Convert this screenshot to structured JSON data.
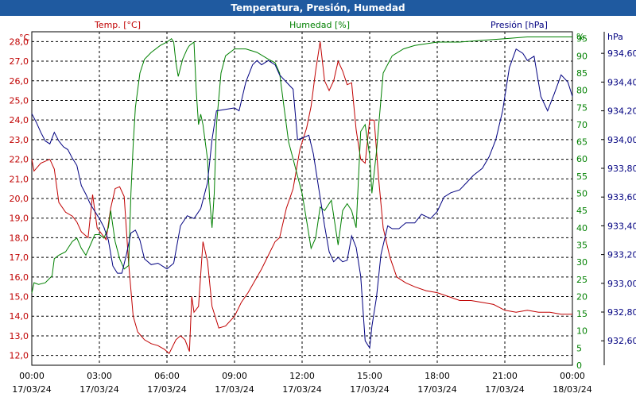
{
  "window": {
    "title": "Temperatura, Presión, Humedad"
  },
  "chart_data": {
    "type": "line",
    "title": "Temperatura, Presión, Humedad",
    "grid": true,
    "x_ticks": [
      {
        "time": "00:00",
        "date": "17/03/24"
      },
      {
        "time": "03:00",
        "date": "17/03/24"
      },
      {
        "time": "06:00",
        "date": "17/03/24"
      },
      {
        "time": "09:00",
        "date": "17/03/24"
      },
      {
        "time": "12:00",
        "date": "17/03/24"
      },
      {
        "time": "15:00",
        "date": "17/03/24"
      },
      {
        "time": "18:00",
        "date": "17/03/24"
      },
      {
        "time": "21:00",
        "date": "17/03/24"
      },
      {
        "time": "00:00",
        "date": "18/03/24"
      }
    ],
    "xlim": [
      0,
      24
    ],
    "axes": {
      "temp": {
        "label": "Temp. [°C]",
        "unit": "°C",
        "color": "#c00000",
        "range": [
          11.5,
          28.5
        ],
        "ticks": [
          "12,0",
          "13,0",
          "14,0",
          "15,0",
          "16,0",
          "17,0",
          "18,0",
          "19,0",
          "20,0",
          "21,0",
          "22,0",
          "23,0",
          "24,0",
          "25,0",
          "26,0",
          "27,0",
          "28,0"
        ],
        "tick_values": [
          12,
          13,
          14,
          15,
          16,
          17,
          18,
          19,
          20,
          21,
          22,
          23,
          24,
          25,
          26,
          27,
          28
        ]
      },
      "hum": {
        "label": "Humedad [%]",
        "unit": "%",
        "color": "#008000",
        "range": [
          0,
          97
        ],
        "ticks": [
          "0",
          "5",
          "10",
          "15",
          "20",
          "25",
          "30",
          "35",
          "40",
          "45",
          "50",
          "55",
          "60",
          "65",
          "70",
          "75",
          "80",
          "85",
          "90",
          "95"
        ],
        "tick_values": [
          0,
          5,
          10,
          15,
          20,
          25,
          30,
          35,
          40,
          45,
          50,
          55,
          60,
          65,
          70,
          75,
          80,
          85,
          90,
          95
        ]
      },
      "pres": {
        "label": "Presión [hPa]",
        "unit": "hPa",
        "color": "#000080",
        "range": [
          932.43,
          934.75
        ],
        "ticks": [
          "932,60",
          "932,80",
          "933,00",
          "933,20",
          "933,40",
          "933,60",
          "933,80",
          "934,00",
          "934,20",
          "934,40",
          "934,60"
        ],
        "tick_values": [
          932.6,
          932.8,
          933.0,
          933.2,
          933.4,
          933.6,
          933.8,
          934.0,
          934.2,
          934.4,
          934.6
        ]
      }
    },
    "series": [
      {
        "name": "Temp. [°C]",
        "axis": "temp",
        "color": "#c00000",
        "points": [
          [
            0,
            22.0
          ],
          [
            0.1,
            21.4
          ],
          [
            0.4,
            21.8
          ],
          [
            0.8,
            22.0
          ],
          [
            1.0,
            21.5
          ],
          [
            1.2,
            19.8
          ],
          [
            1.5,
            19.3
          ],
          [
            1.8,
            19.1
          ],
          [
            2.0,
            18.8
          ],
          [
            2.2,
            18.3
          ],
          [
            2.5,
            18.0
          ],
          [
            2.7,
            20.2
          ],
          [
            2.9,
            18.5
          ],
          [
            3.1,
            18.2
          ],
          [
            3.3,
            17.9
          ],
          [
            3.5,
            19.5
          ],
          [
            3.7,
            20.5
          ],
          [
            3.9,
            20.6
          ],
          [
            4.1,
            20.1
          ],
          [
            4.3,
            16.7
          ],
          [
            4.5,
            14.0
          ],
          [
            4.7,
            13.2
          ],
          [
            5.0,
            12.8
          ],
          [
            5.3,
            12.6
          ],
          [
            5.6,
            12.5
          ],
          [
            5.9,
            12.3
          ],
          [
            6.1,
            12.1
          ],
          [
            6.4,
            12.8
          ],
          [
            6.6,
            13.0
          ],
          [
            6.8,
            12.8
          ],
          [
            7.0,
            12.2
          ],
          [
            7.1,
            15.0
          ],
          [
            7.2,
            14.2
          ],
          [
            7.4,
            14.5
          ],
          [
            7.6,
            17.8
          ],
          [
            7.8,
            16.8
          ],
          [
            8.0,
            14.5
          ],
          [
            8.3,
            13.4
          ],
          [
            8.6,
            13.5
          ],
          [
            9.0,
            14.0
          ],
          [
            9.3,
            14.7
          ],
          [
            9.6,
            15.2
          ],
          [
            9.9,
            15.8
          ],
          [
            10.2,
            16.4
          ],
          [
            10.5,
            17.1
          ],
          [
            10.8,
            17.8
          ],
          [
            11.0,
            18.0
          ],
          [
            11.3,
            19.5
          ],
          [
            11.6,
            20.5
          ],
          [
            11.9,
            22.5
          ],
          [
            12.2,
            23.6
          ],
          [
            12.4,
            24.7
          ],
          [
            12.6,
            26.5
          ],
          [
            12.8,
            28.0
          ],
          [
            13.0,
            26.0
          ],
          [
            13.2,
            25.5
          ],
          [
            13.4,
            26.0
          ],
          [
            13.6,
            27.0
          ],
          [
            13.8,
            26.5
          ],
          [
            14.0,
            25.8
          ],
          [
            14.2,
            25.9
          ],
          [
            14.4,
            23.5
          ],
          [
            14.6,
            22.0
          ],
          [
            14.8,
            21.8
          ],
          [
            15.0,
            24.0
          ],
          [
            15.2,
            24.0
          ],
          [
            15.4,
            21.0
          ],
          [
            15.6,
            18.5
          ],
          [
            15.9,
            17.0
          ],
          [
            16.2,
            16.0
          ],
          [
            16.6,
            15.7
          ],
          [
            17.0,
            15.5
          ],
          [
            17.5,
            15.3
          ],
          [
            18.0,
            15.2
          ],
          [
            18.5,
            15.0
          ],
          [
            19.0,
            14.8
          ],
          [
            19.5,
            14.8
          ],
          [
            20.0,
            14.7
          ],
          [
            20.5,
            14.6
          ],
          [
            21.0,
            14.3
          ],
          [
            21.5,
            14.2
          ],
          [
            22.0,
            14.3
          ],
          [
            22.5,
            14.2
          ],
          [
            23.0,
            14.2
          ],
          [
            23.5,
            14.1
          ],
          [
            24.0,
            14.1
          ]
        ]
      },
      {
        "name": "Humedad [%]",
        "axis": "hum",
        "color": "#008000",
        "points": [
          [
            0,
            21
          ],
          [
            0.1,
            24
          ],
          [
            0.3,
            23.5
          ],
          [
            0.6,
            24
          ],
          [
            0.9,
            26
          ],
          [
            1.0,
            31
          ],
          [
            1.2,
            32
          ],
          [
            1.5,
            33
          ],
          [
            1.8,
            36
          ],
          [
            2.0,
            37
          ],
          [
            2.2,
            34
          ],
          [
            2.4,
            32
          ],
          [
            2.6,
            35
          ],
          [
            2.8,
            38
          ],
          [
            3.0,
            38
          ],
          [
            3.2,
            37
          ],
          [
            3.4,
            40
          ],
          [
            3.5,
            45
          ],
          [
            3.7,
            36
          ],
          [
            3.9,
            31
          ],
          [
            4.1,
            28
          ],
          [
            4.3,
            29
          ],
          [
            4.4,
            50
          ],
          [
            4.5,
            64
          ],
          [
            4.6,
            75
          ],
          [
            4.8,
            85
          ],
          [
            5.0,
            89
          ],
          [
            5.3,
            91
          ],
          [
            5.7,
            93
          ],
          [
            6.0,
            94
          ],
          [
            6.2,
            95
          ],
          [
            6.3,
            94
          ],
          [
            6.4,
            88
          ],
          [
            6.5,
            84
          ],
          [
            6.7,
            89
          ],
          [
            6.9,
            92
          ],
          [
            7.0,
            93
          ],
          [
            7.2,
            94
          ],
          [
            7.3,
            80
          ],
          [
            7.4,
            70
          ],
          [
            7.5,
            73
          ],
          [
            7.6,
            70
          ],
          [
            7.8,
            60
          ],
          [
            7.9,
            48
          ],
          [
            8.0,
            40
          ],
          [
            8.1,
            50
          ],
          [
            8.2,
            70
          ],
          [
            8.4,
            85
          ],
          [
            8.6,
            90
          ],
          [
            9.0,
            92
          ],
          [
            9.5,
            92
          ],
          [
            10.0,
            91
          ],
          [
            10.5,
            89
          ],
          [
            10.8,
            88
          ],
          [
            11.0,
            85
          ],
          [
            11.2,
            75
          ],
          [
            11.4,
            65
          ],
          [
            11.6,
            60
          ],
          [
            11.8,
            55
          ],
          [
            12.0,
            50
          ],
          [
            12.2,
            42
          ],
          [
            12.4,
            34
          ],
          [
            12.6,
            37
          ],
          [
            12.8,
            46
          ],
          [
            13.0,
            45
          ],
          [
            13.3,
            48
          ],
          [
            13.6,
            35
          ],
          [
            13.8,
            45
          ],
          [
            14.0,
            47
          ],
          [
            14.2,
            45
          ],
          [
            14.4,
            40
          ],
          [
            14.6,
            68
          ],
          [
            14.8,
            70
          ],
          [
            15.0,
            61
          ],
          [
            15.1,
            50
          ],
          [
            15.3,
            62
          ],
          [
            15.6,
            85
          ],
          [
            16.0,
            90
          ],
          [
            16.5,
            92
          ],
          [
            17.0,
            93
          ],
          [
            18.0,
            94
          ],
          [
            19.0,
            94
          ],
          [
            20.0,
            94.5
          ],
          [
            21.0,
            95
          ],
          [
            22.0,
            95.5
          ],
          [
            23.0,
            95.5
          ],
          [
            24.0,
            95.5
          ]
        ]
      },
      {
        "name": "Presión [hPa]",
        "axis": "pres",
        "color": "#000080",
        "points": [
          [
            0,
            934.18
          ],
          [
            0.2,
            934.12
          ],
          [
            0.4,
            934.05
          ],
          [
            0.6,
            933.99
          ],
          [
            0.8,
            933.97
          ],
          [
            1.0,
            934.05
          ],
          [
            1.2,
            933.99
          ],
          [
            1.4,
            933.95
          ],
          [
            1.6,
            933.93
          ],
          [
            1.8,
            933.87
          ],
          [
            2.0,
            933.82
          ],
          [
            2.2,
            933.68
          ],
          [
            2.4,
            933.62
          ],
          [
            2.6,
            933.55
          ],
          [
            2.8,
            933.5
          ],
          [
            3.0,
            933.45
          ],
          [
            3.2,
            933.39
          ],
          [
            3.4,
            933.3
          ],
          [
            3.6,
            933.12
          ],
          [
            3.8,
            933.07
          ],
          [
            4.0,
            933.07
          ],
          [
            4.2,
            933.2
          ],
          [
            4.4,
            933.35
          ],
          [
            4.6,
            933.37
          ],
          [
            4.8,
            933.3
          ],
          [
            5.0,
            933.17
          ],
          [
            5.3,
            933.13
          ],
          [
            5.6,
            933.14
          ],
          [
            6.0,
            933.1
          ],
          [
            6.3,
            933.14
          ],
          [
            6.6,
            933.4
          ],
          [
            6.9,
            933.47
          ],
          [
            7.2,
            933.45
          ],
          [
            7.5,
            933.52
          ],
          [
            7.8,
            933.7
          ],
          [
            8.0,
            934.0
          ],
          [
            8.2,
            934.2
          ],
          [
            8.6,
            934.21
          ],
          [
            9.0,
            934.22
          ],
          [
            9.2,
            934.2
          ],
          [
            9.5,
            934.4
          ],
          [
            9.8,
            934.52
          ],
          [
            10.0,
            934.55
          ],
          [
            10.2,
            934.52
          ],
          [
            10.5,
            934.55
          ],
          [
            10.8,
            934.52
          ],
          [
            11.0,
            934.45
          ],
          [
            11.3,
            934.4
          ],
          [
            11.6,
            934.35
          ],
          [
            11.8,
            934.0
          ],
          [
            12.0,
            934.01
          ],
          [
            12.3,
            934.03
          ],
          [
            12.5,
            933.9
          ],
          [
            12.7,
            933.7
          ],
          [
            13.0,
            933.4
          ],
          [
            13.2,
            933.22
          ],
          [
            13.4,
            933.15
          ],
          [
            13.6,
            933.18
          ],
          [
            13.8,
            933.15
          ],
          [
            14.0,
            933.16
          ],
          [
            14.2,
            933.33
          ],
          [
            14.4,
            933.25
          ],
          [
            14.6,
            933.05
          ],
          [
            14.8,
            932.6
          ],
          [
            15.0,
            932.55
          ],
          [
            15.1,
            932.7
          ],
          [
            15.3,
            932.9
          ],
          [
            15.5,
            933.2
          ],
          [
            15.8,
            933.4
          ],
          [
            16.0,
            933.38
          ],
          [
            16.3,
            933.38
          ],
          [
            16.6,
            933.42
          ],
          [
            17.0,
            933.42
          ],
          [
            17.3,
            933.48
          ],
          [
            17.7,
            933.45
          ],
          [
            18.0,
            933.5
          ],
          [
            18.3,
            933.6
          ],
          [
            18.6,
            933.63
          ],
          [
            19.0,
            933.65
          ],
          [
            19.3,
            933.7
          ],
          [
            19.6,
            933.75
          ],
          [
            20.0,
            933.8
          ],
          [
            20.3,
            933.88
          ],
          [
            20.6,
            934.0
          ],
          [
            20.9,
            934.2
          ],
          [
            21.2,
            934.5
          ],
          [
            21.5,
            934.63
          ],
          [
            21.8,
            934.6
          ],
          [
            22.0,
            934.55
          ],
          [
            22.3,
            934.58
          ],
          [
            22.6,
            934.3
          ],
          [
            22.9,
            934.2
          ],
          [
            23.2,
            934.32
          ],
          [
            23.5,
            934.45
          ],
          [
            23.8,
            934.4
          ],
          [
            24.0,
            934.3
          ]
        ]
      }
    ]
  }
}
